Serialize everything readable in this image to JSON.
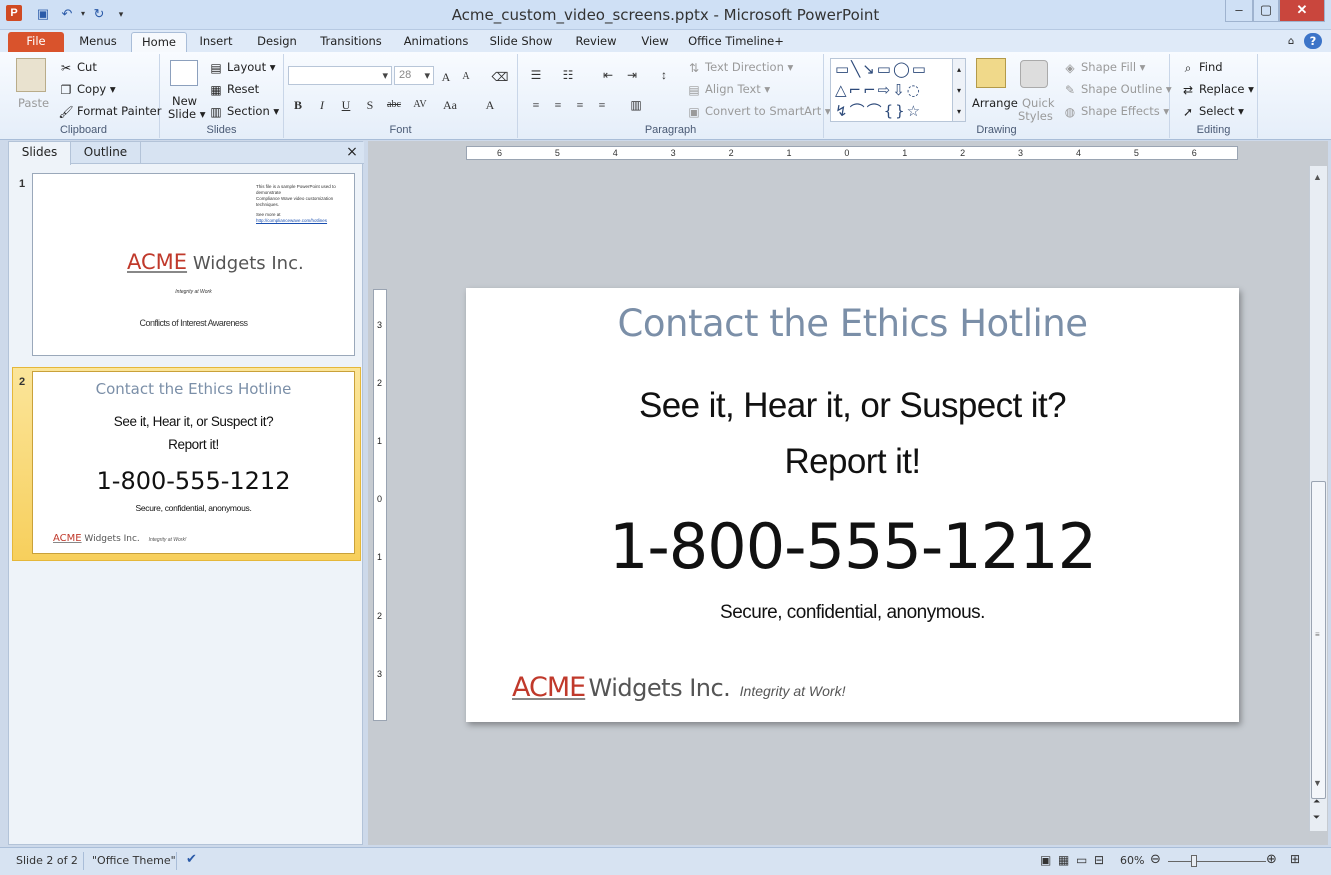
{
  "window": {
    "title": "Acme_custom_video_screens.pptx - Microsoft PowerPoint"
  },
  "tabs": [
    "File",
    "Menus",
    "Home",
    "Insert",
    "Design",
    "Transitions",
    "Animations",
    "Slide Show",
    "Review",
    "View",
    "Office Timeline+"
  ],
  "ribbon": {
    "clipboard": {
      "paste": "Paste",
      "cut": "Cut",
      "copy": "Copy",
      "format_painter": "Format Painter",
      "label": "Clipboard"
    },
    "slides": {
      "new_slide_1": "New",
      "new_slide_2": "Slide",
      "layout": "Layout",
      "reset": "Reset",
      "section": "Section",
      "label": "Slides"
    },
    "font": {
      "size": "28",
      "label": "Font"
    },
    "paragraph": {
      "text_direction": "Text Direction",
      "align_text": "Align Text",
      "convert_smartart": "Convert to SmartArt",
      "label": "Paragraph"
    },
    "drawing": {
      "arrange": "Arrange",
      "quick_styles_1": "Quick",
      "quick_styles_2": "Styles",
      "shape_fill": "Shape Fill",
      "shape_outline": "Shape Outline",
      "shape_effects": "Shape Effects",
      "label": "Drawing"
    },
    "editing": {
      "find": "Find",
      "replace": "Replace",
      "select": "Select",
      "label": "Editing"
    }
  },
  "panel": {
    "tab_slides": "Slides",
    "tab_outline": "Outline",
    "close": "×",
    "slide1": {
      "num": "1",
      "note_line1": "This file is a sample PowerPoint used to demonstrate",
      "note_line2": "Compliance Wave video customization techniques.",
      "note_line3_prefix": "See more at",
      "note_link": "http://compliancewave.com/hotlines",
      "logo_acme": "ACME",
      "logo_widgets": "Widgets Inc.",
      "tagline": "Integrity at Work",
      "subtitle": "Conflicts of Interest Awareness"
    },
    "slide2": {
      "num": "2"
    }
  },
  "slide": {
    "title": "Contact the Ethics Hotline",
    "line1": "See it, Hear it, or Suspect it?",
    "line2": "Report it!",
    "phone": "1-800-555-1212",
    "secure": "Secure, confidential, anonymous.",
    "logo_acme": "ACME",
    "logo_widgets": "Widgets Inc.",
    "tagline": "Integrity at Work!"
  },
  "ruler": {
    "h_labels": [
      "6",
      "5",
      "4",
      "3",
      "2",
      "1",
      "0",
      "1",
      "2",
      "3",
      "4",
      "5",
      "6"
    ],
    "v_labels": [
      "3",
      "2",
      "1",
      "0",
      "1",
      "2",
      "3"
    ]
  },
  "status": {
    "slide_info": "Slide 2 of 2",
    "theme": "\"Office Theme\"",
    "zoom": "60%"
  }
}
